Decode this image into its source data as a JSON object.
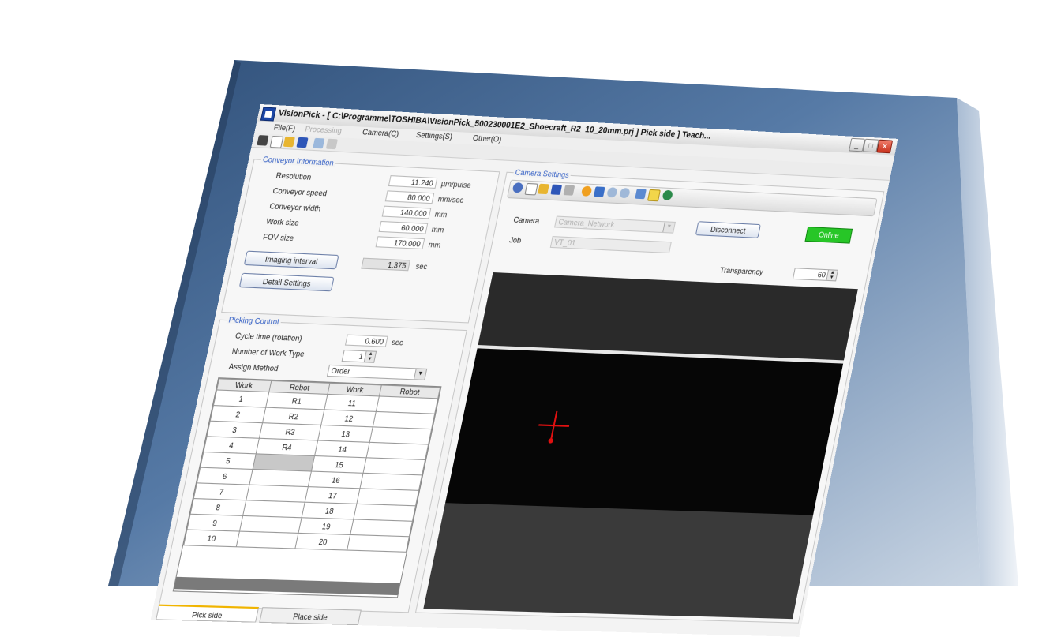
{
  "window": {
    "title": "VisionPick - [ C:\\Programme\\TOSHIBA\\VisionPick_500230001E2_Shoecraft_R2_10_20mm.prj ] Pick side ] Teach...",
    "minimize_glyph": "_",
    "maximize_glyph": "□",
    "close_glyph": "✕"
  },
  "menu": {
    "items": [
      "File(F)",
      "Processing",
      "Camera(C)",
      "Settings(S)",
      "Other(O)"
    ]
  },
  "conveyor": {
    "title": "Conveyor Information",
    "rows": [
      {
        "label": "Resolution",
        "value": "11.240",
        "unit": "µm/pulse"
      },
      {
        "label": "Conveyor speed",
        "value": "80.000",
        "unit": "mm/sec"
      },
      {
        "label": "Conveyor width",
        "value": "140.000",
        "unit": "mm"
      },
      {
        "label": "Work size",
        "value": "60.000",
        "unit": "mm"
      },
      {
        "label": "FOV size",
        "value": "170.000",
        "unit": "mm"
      }
    ],
    "imaging_interval_button": "Imaging interval",
    "imaging_interval_value": "1.375",
    "imaging_interval_unit": "sec",
    "detail_settings_button": "Detail Settings"
  },
  "picking": {
    "title": "Picking Control",
    "cycle_time_label": "Cycle time (rotation)",
    "cycle_time_value": "0.600",
    "cycle_time_unit": "sec",
    "work_type_label": "Number of Work Type",
    "work_type_value": "1",
    "assign_method_label": "Assign Method",
    "assign_method_value": "Order",
    "table_headers": [
      "Work",
      "Robot",
      "Work",
      "Robot"
    ],
    "table_rows": [
      [
        "1",
        "R1",
        "11",
        ""
      ],
      [
        "2",
        "R2",
        "12",
        ""
      ],
      [
        "3",
        "R3",
        "13",
        ""
      ],
      [
        "4",
        "R4",
        "14",
        ""
      ],
      [
        "5",
        "",
        "15",
        ""
      ],
      [
        "6",
        "",
        "16",
        ""
      ],
      [
        "7",
        "",
        "17",
        ""
      ],
      [
        "8",
        "",
        "18",
        ""
      ],
      [
        "9",
        "",
        "19",
        ""
      ],
      [
        "10",
        "",
        "20",
        ""
      ]
    ]
  },
  "camera": {
    "title": "Camera Settings",
    "camera_label": "Camera",
    "camera_value": "Camera_Network",
    "job_label": "Job",
    "job_value": "VT_01",
    "disconnect_button": "Disconnect",
    "status": "Online",
    "status_color": "#27c627",
    "transparency_label": "Transparency",
    "transparency_value": "60",
    "crosshair_color": "#e01010"
  },
  "tabs": [
    "Pick side",
    "Place side"
  ]
}
